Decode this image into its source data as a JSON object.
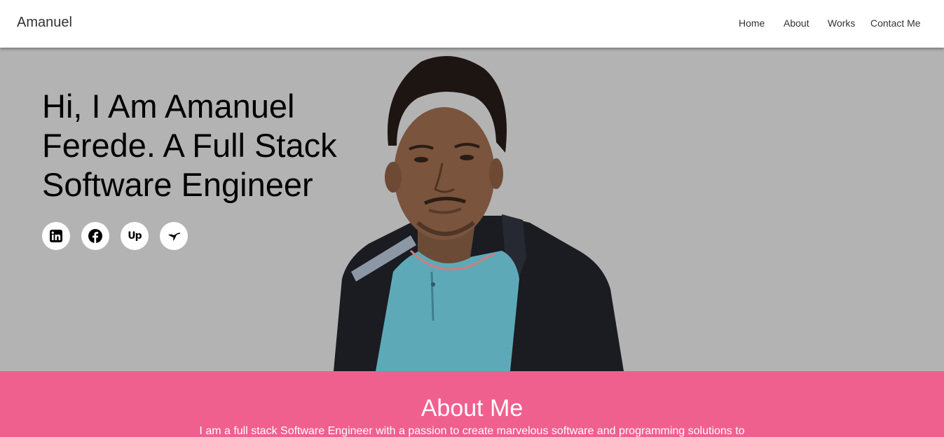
{
  "navbar": {
    "brand": "Amanuel",
    "links": [
      "Home",
      "About",
      "Works",
      "Contact Me"
    ]
  },
  "hero": {
    "title": "Hi, I Am Amanuel Ferede. A Full Stack Software Engineer",
    "social": [
      {
        "name": "linkedin-icon"
      },
      {
        "name": "facebook-icon"
      },
      {
        "name": "upwork-icon",
        "glyph": "Up"
      },
      {
        "name": "hummingbird-icon"
      }
    ],
    "portrait": "profile-photo"
  },
  "about": {
    "title": "About Me",
    "text": "I am a full stack Software Engineer with a passion to create marvelous software and programming solutions to"
  },
  "colors": {
    "hero_bg": "#b3b3b3",
    "about_bg": "#f0608f",
    "navbar_bg": "#ffffff"
  }
}
